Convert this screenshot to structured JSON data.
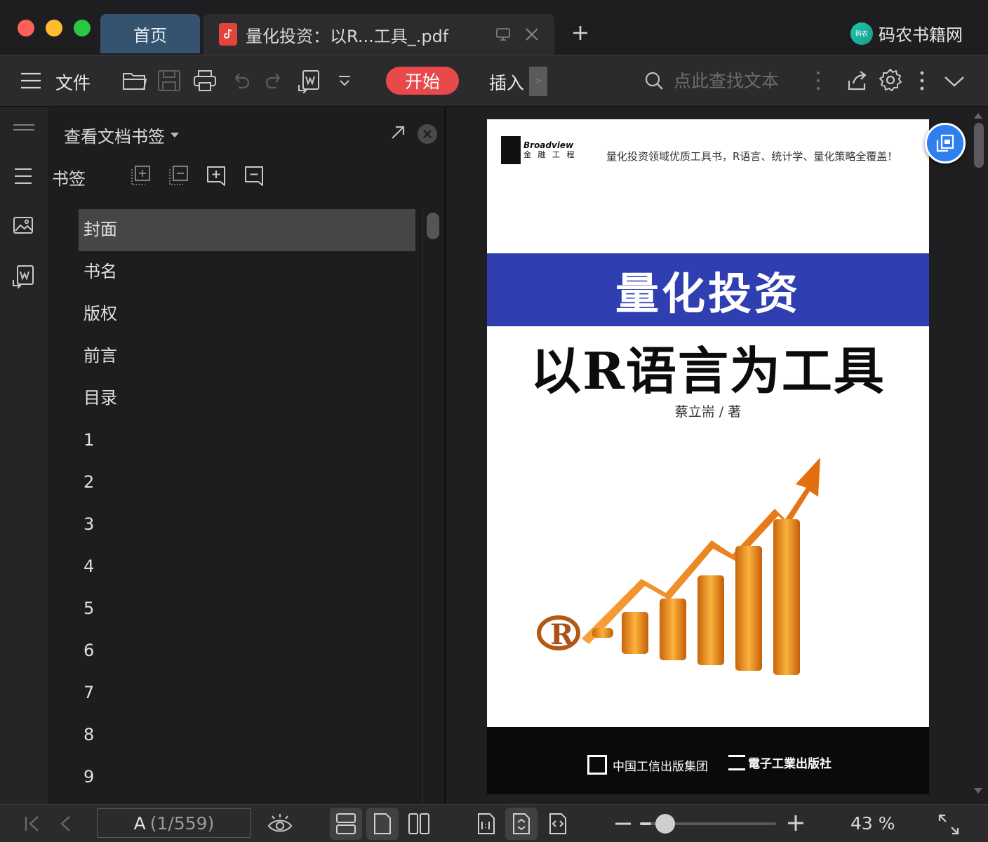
{
  "tabs": {
    "home_label": "首页",
    "doc_title": "量化投资：以R...工具_.pdf"
  },
  "brand": {
    "name": "码农书籍网",
    "logo_text": "码农"
  },
  "toolbar": {
    "file_label": "文件",
    "start_label": "开始",
    "insert_label": "插入",
    "more_tabs_label": ">",
    "search_placeholder": "点此查找文本"
  },
  "bookmark_panel": {
    "title": "查看文档书签",
    "section_label": "书签",
    "items": [
      "封面",
      "书名",
      "版权",
      "前言",
      "目录",
      "1",
      "2",
      "3",
      "4",
      "5",
      "6",
      "7",
      "8",
      "9"
    ],
    "selected_index": 0
  },
  "cover": {
    "publisher_logo_en": "Broadview",
    "publisher_logo_cn": "金 融 工 程",
    "slogan": "量化投资领域优质工具书，R语言、统计学、量化策略全覆盖！",
    "title": "量化投资",
    "subtitle": "以R语言为工具",
    "author": "蔡立耑  /  著",
    "r_logo": "R",
    "publisher_1": "中国工信出版集团",
    "publisher_2": "電子工業出版社"
  },
  "statusbar": {
    "page_label": "A",
    "page_position": "(1/559)",
    "zoom_percent": 43,
    "zoom_text": "43 %"
  },
  "colors": {
    "accent_start": "#e8494a",
    "home_tab": "#35536f",
    "cover_band": "#2f3fb2",
    "float_button": "#2f7ff0"
  }
}
